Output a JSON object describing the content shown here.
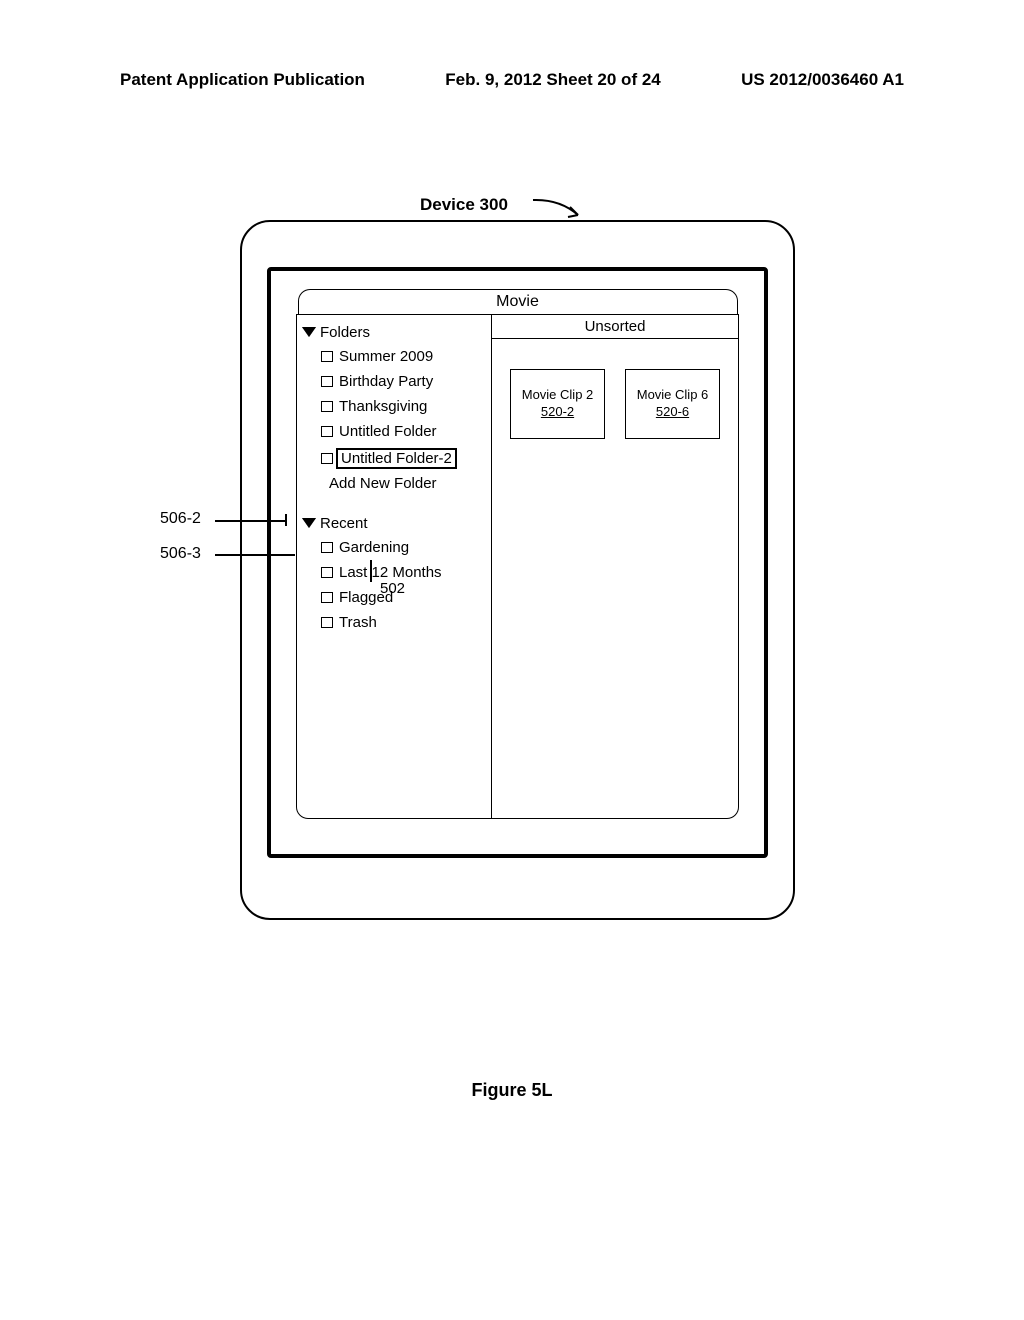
{
  "header": {
    "left": "Patent Application Publication",
    "mid": "Feb. 9, 2012  Sheet 20 of 24",
    "right": "US 2012/0036460 A1"
  },
  "device_label": "Device 300",
  "app_title": "Movie",
  "sidebar": {
    "folders_header": "Folders",
    "items": [
      {
        "label": "Summer 2009"
      },
      {
        "label": "Birthday Party"
      },
      {
        "label": "Thanksgiving"
      },
      {
        "label": "Untitled Folder"
      },
      {
        "label": "Untitled Folder-2",
        "selected": true
      }
    ],
    "add_new": "Add New Folder",
    "recent_header": "Recent",
    "recent": [
      {
        "label": "Gardening"
      },
      {
        "label": "Last 12 Months"
      },
      {
        "label": "Flagged"
      },
      {
        "label": "Trash"
      }
    ]
  },
  "content": {
    "title": "Unsorted",
    "clips": [
      {
        "name": "Movie Clip 2",
        "ref": "520-2"
      },
      {
        "name": "Movie Clip 6",
        "ref": "520-6"
      }
    ]
  },
  "callouts": {
    "c1": "506-2",
    "c2": "506-3",
    "c3": "502"
  },
  "figure_label": "Figure 5L"
}
